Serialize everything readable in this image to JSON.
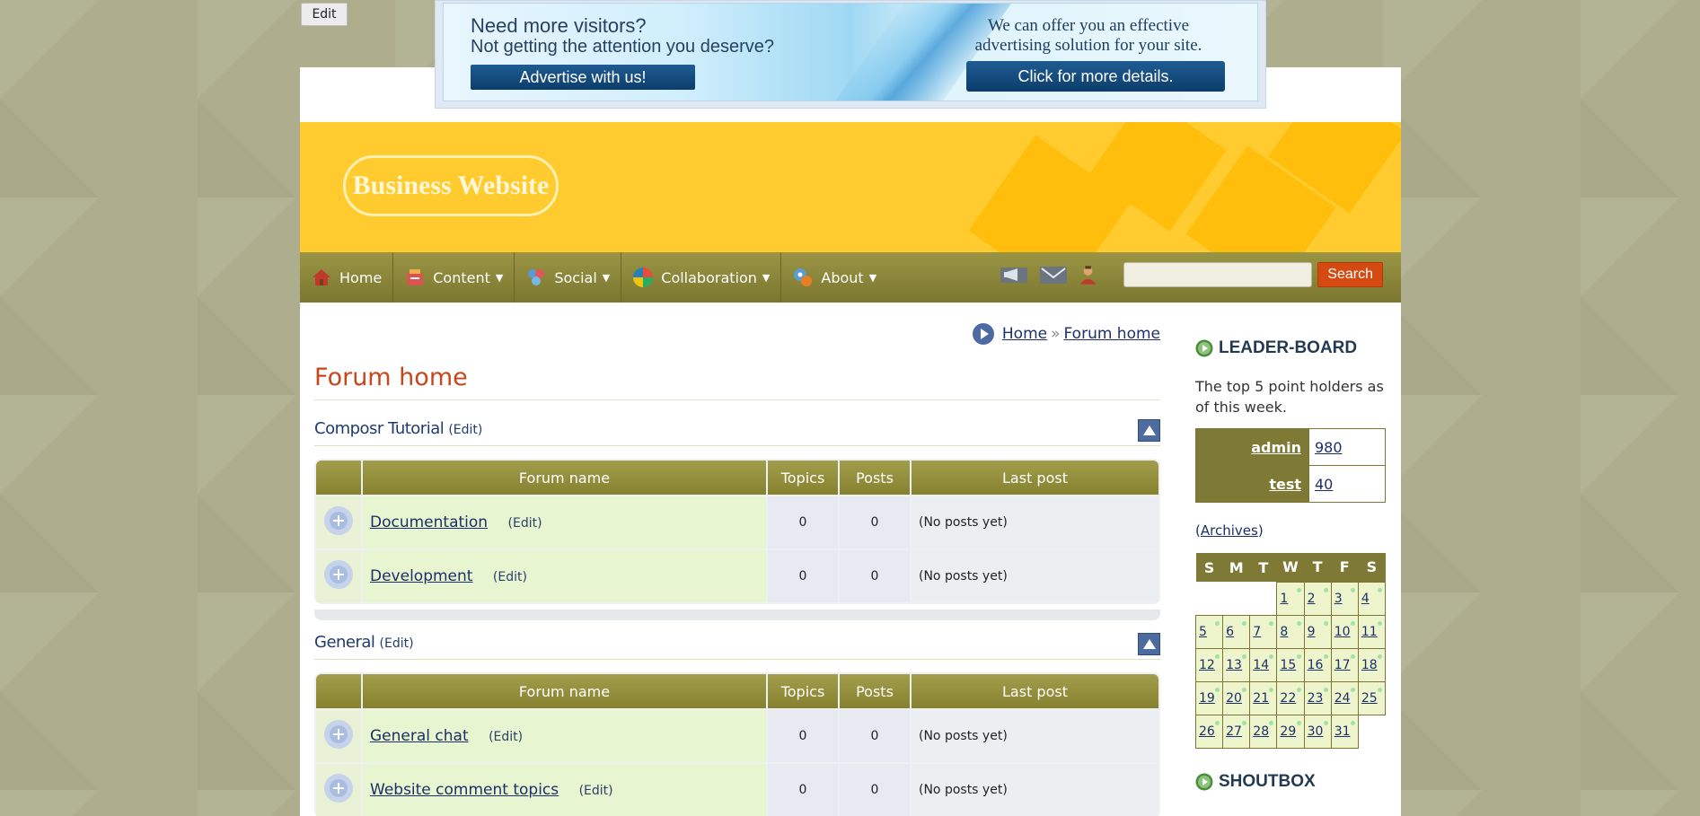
{
  "topbar": {
    "edit_label": "Edit"
  },
  "banner": {
    "headline1": "Need more visitors?",
    "headline2": "Not getting the attention you deserve?",
    "left_button": "Advertise with us!",
    "right_text_line1": "We can offer you an effective",
    "right_text_line2": "advertising solution for your site.",
    "right_button": "Click for more details."
  },
  "header": {
    "logo_text": "Business Website"
  },
  "nav": {
    "items": [
      {
        "label": "Home",
        "icon": "home-icon",
        "dropdown": false
      },
      {
        "label": "Content",
        "icon": "content-icon",
        "dropdown": true
      },
      {
        "label": "Social",
        "icon": "social-icon",
        "dropdown": true
      },
      {
        "label": "Collaboration",
        "icon": "collaboration-icon",
        "dropdown": true
      },
      {
        "label": "About",
        "icon": "about-icon",
        "dropdown": true
      }
    ],
    "search_button": "Search",
    "search_placeholder": ""
  },
  "breadcrumb": {
    "home": "Home",
    "sep": "»",
    "current": "Forum home"
  },
  "page_title": "Forum home",
  "sections": [
    {
      "name": "Composr Tutorial",
      "edit": "(Edit)",
      "headers": [
        "Forum name",
        "Topics",
        "Posts",
        "Last post"
      ],
      "rows": [
        {
          "name": "Documentation",
          "edit": "(Edit)",
          "topics": "0",
          "posts": "0",
          "last": "(No posts yet)"
        },
        {
          "name": "Development",
          "edit": "(Edit)",
          "topics": "0",
          "posts": "0",
          "last": "(No posts yet)"
        }
      ]
    },
    {
      "name": "General",
      "edit": "(Edit)",
      "headers": [
        "Forum name",
        "Topics",
        "Posts",
        "Last post"
      ],
      "rows": [
        {
          "name": "General chat",
          "edit": "(Edit)",
          "topics": "0",
          "posts": "0",
          "last": "(No posts yet)"
        },
        {
          "name": "Website comment topics",
          "edit": "(Edit)",
          "topics": "0",
          "posts": "0",
          "last": "(No posts yet)"
        }
      ]
    }
  ],
  "sidebar": {
    "leaderboard_title": "LEADER-BOARD",
    "leaderboard_desc": "The top 5 point holders as of this week.",
    "leaders": [
      {
        "user": "admin",
        "points": "980"
      },
      {
        "user": "test",
        "points": "40"
      }
    ],
    "archives_open": "(",
    "archives_label": "Archives",
    "archives_close": ")",
    "calendar_days": [
      "S",
      "M",
      "T",
      "W",
      "T",
      "F",
      "S"
    ],
    "calendar_weeks": [
      [
        "",
        "",
        "",
        "1",
        "2",
        "3",
        "4"
      ],
      [
        "5",
        "6",
        "7",
        "8",
        "9",
        "10",
        "11"
      ],
      [
        "12",
        "13",
        "14",
        "15",
        "16",
        "17",
        "18"
      ],
      [
        "19",
        "20",
        "21",
        "22",
        "23",
        "24",
        "25"
      ],
      [
        "26",
        "27",
        "28",
        "29",
        "30",
        "31",
        ""
      ]
    ],
    "shoutbox_title": "SHOUTBOX"
  }
}
